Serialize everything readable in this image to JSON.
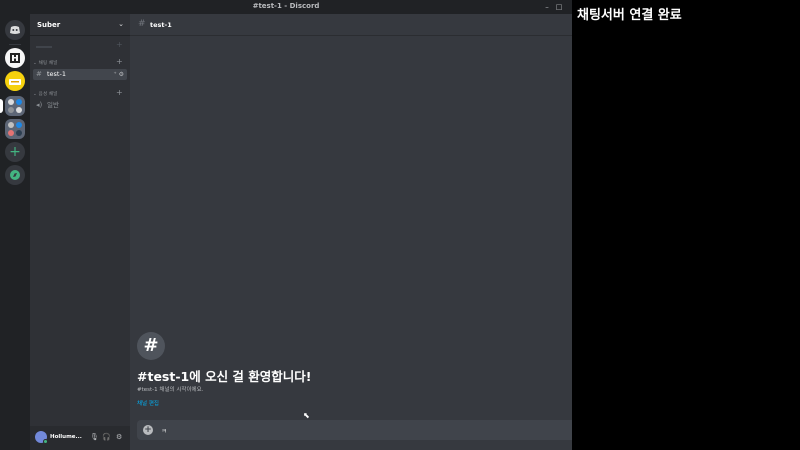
{
  "window": {
    "title": "#test-1 - Discord"
  },
  "rail": {
    "servers": [
      {
        "name": "discord-home",
        "color": "#5865f2",
        "label": ""
      },
      {
        "name": "server-1",
        "color": "#f6f6f6",
        "label": ""
      },
      {
        "name": "server-2",
        "color": "#f5d10e",
        "label": ""
      },
      {
        "name": "server-folder-1",
        "color": "#5d6676",
        "label": ""
      },
      {
        "name": "server-folder-2",
        "color": "#5d6676",
        "label": ""
      }
    ],
    "add_server": "+",
    "explore": "➤"
  },
  "guild": {
    "name": "Suber"
  },
  "categories": [
    {
      "label": "채팅 채널",
      "channels": [
        {
          "name": "test-1",
          "active": true
        }
      ]
    },
    {
      "label": "음성 채널",
      "channels": [
        {
          "name": "일반",
          "active": false
        }
      ]
    }
  ],
  "user": {
    "name": "Hollume..."
  },
  "channel": {
    "name": "test-1"
  },
  "welcome": {
    "icon": "#",
    "title": "#test-1에 오신 걸 환영합니다!",
    "subtitle": "#test-1 채널의 시작이에요.",
    "link": "채널 편집"
  },
  "composer": {
    "text": "ㅋ"
  },
  "overlay_caption": "채팅서버 연결 완료",
  "colors": {
    "rail": "#202225",
    "sidebar": "#2f3136",
    "main": "#36393f",
    "composer": "#40444b",
    "link": "#00b0f4",
    "online": "#43b581"
  }
}
